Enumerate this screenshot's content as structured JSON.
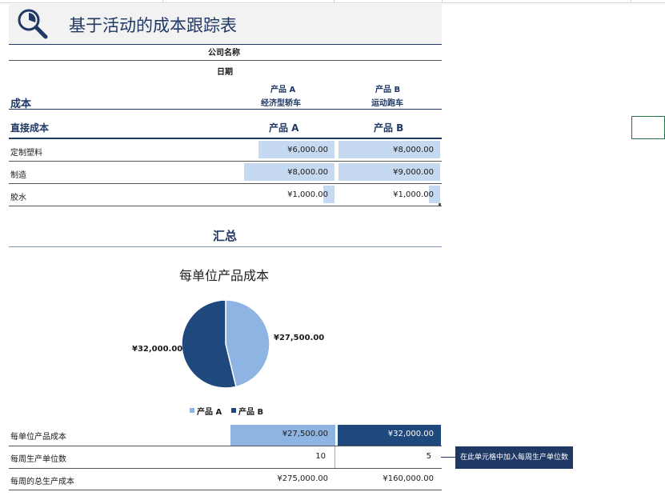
{
  "title": "基于活动的成本跟踪表",
  "company": "公司名称",
  "date": "日期",
  "cost_heading": "成本",
  "products_header": [
    {
      "name": "产品 A",
      "sub": "经济型轿车"
    },
    {
      "name": "产品 B",
      "sub": "运动跑车"
    }
  ],
  "direct_cost": {
    "heading": "直接成本",
    "col_a": "产品 A",
    "col_b": "产品 B",
    "rows": [
      {
        "label": "定制塑料",
        "a": "¥6,000.00",
        "b": "¥8,000.00",
        "a_fill": 0.75,
        "b_fill": 1.0
      },
      {
        "label": "制造",
        "a": "¥8,000.00",
        "b": "¥9,000.00",
        "a_fill": 0.89,
        "b_fill": 1.0
      },
      {
        "label": "胶水",
        "a": "¥1,000.00",
        "b": "¥1,000.00",
        "a_fill": 0.11,
        "b_fill": 0.11
      }
    ]
  },
  "summary": {
    "heading": "汇总",
    "chart": {
      "title": "每单位产品成本",
      "label_a": "¥27,500.00",
      "label_b": "¥32,000.00",
      "legend_a": "产品 A",
      "legend_b": "产品 B",
      "color_a": "#8eb4e3",
      "color_b": "#1f497d"
    },
    "rows": [
      {
        "label": "每单位产品成本",
        "a": "¥27,500.00",
        "b": "¥32,000.00"
      },
      {
        "label": "每周生产单位数",
        "a": "10",
        "b": "5"
      },
      {
        "label": "每周的总生产成本",
        "a": "¥275,000.00",
        "b": "¥160,000.00"
      }
    ]
  },
  "tooltip": "在此单元格中加入每周生产单位数",
  "chart_data": {
    "type": "pie",
    "title": "每单位产品成本",
    "categories": [
      "产品 A",
      "产品 B"
    ],
    "values": [
      27500,
      32000
    ],
    "legend": "bottom"
  }
}
